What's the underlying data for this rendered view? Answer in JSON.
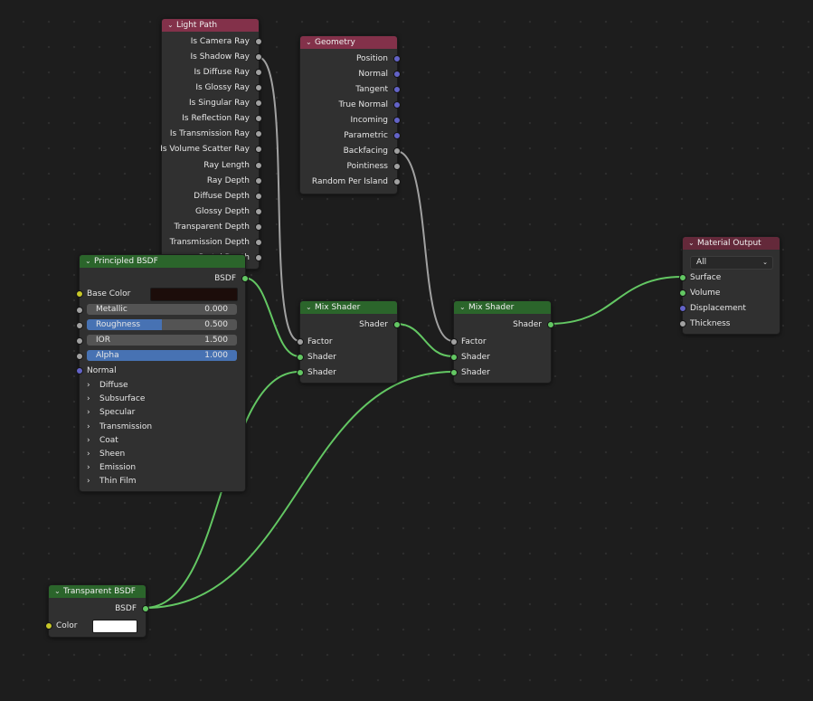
{
  "nodes": {
    "light_path": {
      "title": "Light Path",
      "outputs": [
        "Is Camera Ray",
        "Is Shadow Ray",
        "Is Diffuse Ray",
        "Is Glossy Ray",
        "Is Singular Ray",
        "Is Reflection Ray",
        "Is Transmission Ray",
        "Is Volume Scatter Ray",
        "Ray Length",
        "Ray Depth",
        "Diffuse Depth",
        "Glossy Depth",
        "Transparent Depth",
        "Transmission Depth",
        "Portal Depth"
      ]
    },
    "geometry": {
      "title": "Geometry",
      "outputs": [
        "Position",
        "Normal",
        "Tangent",
        "True Normal",
        "Incoming",
        "Parametric",
        "Backfacing",
        "Pointiness",
        "Random Per Island"
      ]
    },
    "principled_bsdf": {
      "title": "Principled BSDF",
      "output": "BSDF",
      "base_color_label": "Base Color",
      "base_color": "#1c0d0a",
      "fields": [
        {
          "label": "Metallic",
          "value": "0.000",
          "fraction": 0.0
        },
        {
          "label": "Roughness",
          "value": "0.500",
          "fraction": 0.5
        },
        {
          "label": "IOR",
          "value": "1.500",
          "fraction": 0.0
        },
        {
          "label": "Alpha",
          "value": "1.000",
          "fraction": 1.0
        }
      ],
      "normal_label": "Normal",
      "panels": [
        "Diffuse",
        "Subsurface",
        "Specular",
        "Transmission",
        "Coat",
        "Sheen",
        "Emission",
        "Thin Film"
      ]
    },
    "mix_shader_1": {
      "title": "Mix Shader",
      "output": "Shader",
      "inputs": [
        "Factor",
        "Shader",
        "Shader"
      ]
    },
    "mix_shader_2": {
      "title": "Mix Shader",
      "output": "Shader",
      "inputs": [
        "Factor",
        "Shader",
        "Shader"
      ]
    },
    "material_output": {
      "title": "Material Output",
      "target": "All",
      "inputs": [
        "Surface",
        "Volume",
        "Displacement",
        "Thickness"
      ]
    },
    "transparent_bsdf": {
      "title": "Transparent BSDF",
      "output": "BSDF",
      "color_label": "Color",
      "color": "#ffffff"
    }
  },
  "colors": {
    "input_header": "#83314a",
    "shader_header": "#2b652b",
    "output_header": "#64293a",
    "shader_socket": "#63c763",
    "float_socket": "#a1a1a1",
    "vector_socket": "#6363c7",
    "color_socket": "#c7c729",
    "shader_link": "#63c763",
    "float_link": "#a1a1a1"
  }
}
